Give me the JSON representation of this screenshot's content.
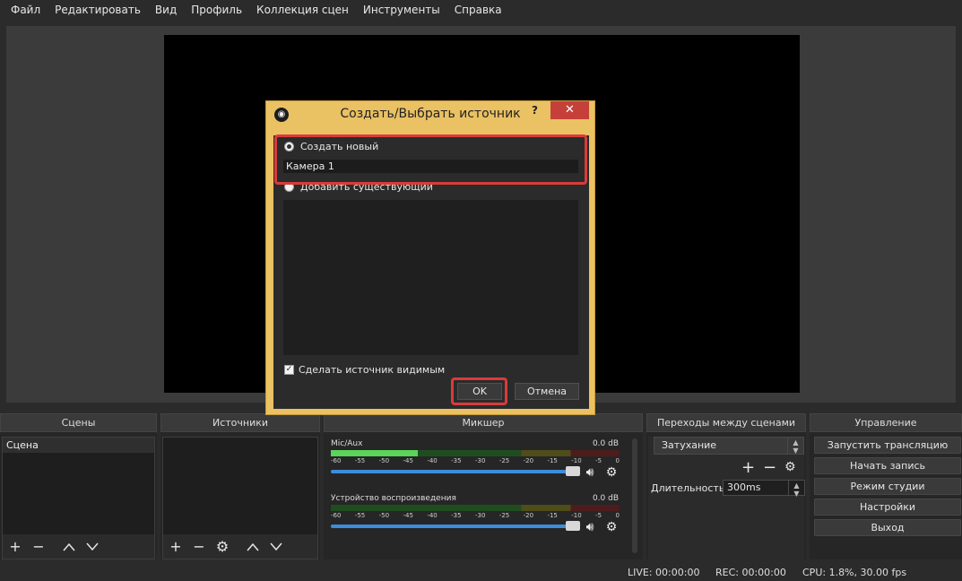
{
  "menu": [
    "Файл",
    "Редактировать",
    "Вид",
    "Профиль",
    "Коллекция сцен",
    "Инструменты",
    "Справка"
  ],
  "docks": {
    "scenes": {
      "title": "Сцены",
      "items": [
        "Сцена"
      ]
    },
    "sources": {
      "title": "Источники"
    },
    "mixer": {
      "title": "Микшер",
      "ticks": [
        "-60",
        "-55",
        "-50",
        "-45",
        "-40",
        "-35",
        "-30",
        "-25",
        "-20",
        "-15",
        "-10",
        "-5",
        "0"
      ],
      "channels": [
        {
          "name": "Mic/Aux",
          "db": "0.0 dB",
          "level_fraction": 0.3
        },
        {
          "name": "Устройство воспроизведения",
          "db": "0.0 dB",
          "level_fraction": 0.0
        }
      ]
    },
    "transitions": {
      "title": "Переходы между сценами",
      "selected": "Затухание",
      "duration_label": "Длительность",
      "duration_value": "300ms"
    },
    "controls": {
      "title": "Управление",
      "buttons": [
        "Запустить трансляцию",
        "Начать запись",
        "Режим студии",
        "Настройки",
        "Выход"
      ]
    }
  },
  "status": {
    "live": "LIVE: 00:00:00",
    "rec": "REC: 00:00:00",
    "cpu": "CPU: 1.8%, 30.00 fps"
  },
  "dialog": {
    "title": "Создать/Выбрать источник",
    "help": "?",
    "close": "✕",
    "create_new_label": "Создать новый",
    "name_value": "Камера 1",
    "add_existing_label": "Добавить существующий",
    "visible_label": "Сделать источник видимым",
    "ok_label": "OK",
    "cancel_label": "Отмена",
    "highlight_color": "#d93b3b"
  }
}
